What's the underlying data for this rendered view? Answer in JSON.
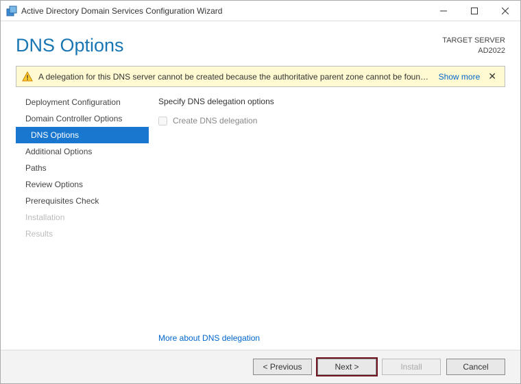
{
  "titlebar": {
    "text": "Active Directory Domain Services Configuration Wizard"
  },
  "header": {
    "title": "DNS Options",
    "target_label": "TARGET SERVER",
    "target_value": "AD2022"
  },
  "banner": {
    "message": "A delegation for this DNS server cannot be created because the authoritative parent zone cannot be found...",
    "show_more": "Show more"
  },
  "sidebar": {
    "items": [
      {
        "label": "Deployment Configuration",
        "state": "normal"
      },
      {
        "label": "Domain Controller Options",
        "state": "normal"
      },
      {
        "label": "DNS Options",
        "state": "selected"
      },
      {
        "label": "Additional Options",
        "state": "normal"
      },
      {
        "label": "Paths",
        "state": "normal"
      },
      {
        "label": "Review Options",
        "state": "normal"
      },
      {
        "label": "Prerequisites Check",
        "state": "normal"
      },
      {
        "label": "Installation",
        "state": "disabled"
      },
      {
        "label": "Results",
        "state": "disabled"
      }
    ]
  },
  "main": {
    "section_label": "Specify DNS delegation options",
    "checkbox_label": "Create DNS delegation",
    "checkbox_checked": false,
    "more_link": "More about DNS delegation"
  },
  "footer": {
    "previous": "< Previous",
    "next": "Next >",
    "install": "Install",
    "cancel": "Cancel"
  }
}
